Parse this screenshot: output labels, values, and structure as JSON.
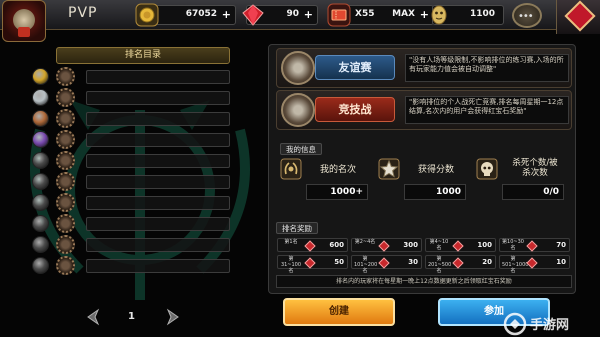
{
  "header": {
    "mode_title": "PVP",
    "resources": [
      {
        "icon": "gold-coin-icon",
        "value": "67052",
        "plus": "+"
      },
      {
        "icon": "red-gem-icon",
        "value": "90",
        "plus": "+"
      },
      {
        "icon": "ticket-icon",
        "count": "X55",
        "value": "MAX",
        "plus": "+"
      },
      {
        "icon": "gold-idol-icon",
        "value": "1100"
      }
    ],
    "chat_icon_glyph": "•••"
  },
  "ranking": {
    "header_label": "排名目录",
    "rows": [
      {
        "medal": "gold-medal-icon",
        "color": "#d4a62a"
      },
      {
        "medal": "silver-medal-icon",
        "color": "#b8c0c4"
      },
      {
        "medal": "bronze-medal-icon",
        "color": "#b06a3a"
      },
      {
        "medal": "purple-medal-icon",
        "color": "#7a4ab0"
      },
      {
        "medal": "gray-medal-icon",
        "color": "#4a4a4a"
      },
      {
        "medal": "gray-medal-icon",
        "color": "#4a4a4a"
      },
      {
        "medal": "gray-medal-icon",
        "color": "#4a4a4a"
      },
      {
        "medal": "gray-medal-icon",
        "color": "#4a4a4a"
      },
      {
        "medal": "gray-medal-icon",
        "color": "#4a4a4a"
      },
      {
        "medal": "gray-medal-icon",
        "color": "#4a4a4a"
      }
    ],
    "page": "1"
  },
  "modes": {
    "friendly": {
      "label": "友谊赛",
      "desc": "\"没有人场等级限制,不影响排位的练习赛,入场的所有玩家能力值会被自动调整\""
    },
    "ranked": {
      "label": "竞技战",
      "desc": "\"影响排位的个人战死亡竞赛,排名每周星期一12点结算,名次内的用户会获得红宝石奖励\""
    }
  },
  "my_info": {
    "title": "我的信息",
    "stats": [
      {
        "label": "我的名次",
        "value": "1000+",
        "icon": "rank-laurel-icon"
      },
      {
        "label": "获得分数",
        "value": "1000",
        "icon": "star-score-icon"
      },
      {
        "label": "杀死个数/被杀次数",
        "label_line1": "杀死个数/被",
        "label_line2": "杀次数",
        "value": "0/0",
        "icon": "skull-kill-icon"
      }
    ]
  },
  "rewards": {
    "title": "排名奖励",
    "cells": [
      {
        "rank": "第1名",
        "amount": "600"
      },
      {
        "rank": "第2~4名",
        "amount": "300"
      },
      {
        "rank": "第4~10名",
        "amount": "100"
      },
      {
        "rank": "第10~30名",
        "amount": "70"
      },
      {
        "rank": "第31~100名",
        "amount": "50"
      },
      {
        "rank": "第101~200名",
        "amount": "30"
      },
      {
        "rank": "第201~500名",
        "amount": "20"
      },
      {
        "rank": "第501~1000名",
        "amount": "10"
      }
    ],
    "note": "排名内的玩家将在每星期一晚上12点数据更新之后领取红宝石奖励"
  },
  "buttons": {
    "create": "创建",
    "join": "参加"
  },
  "colors": {
    "accent_gold": "#d4a62a",
    "friendly_blue": "#2d5a8a",
    "ranked_red": "#9a2a1a",
    "create_orange": "#f0a020",
    "join_blue": "#2890d8"
  }
}
